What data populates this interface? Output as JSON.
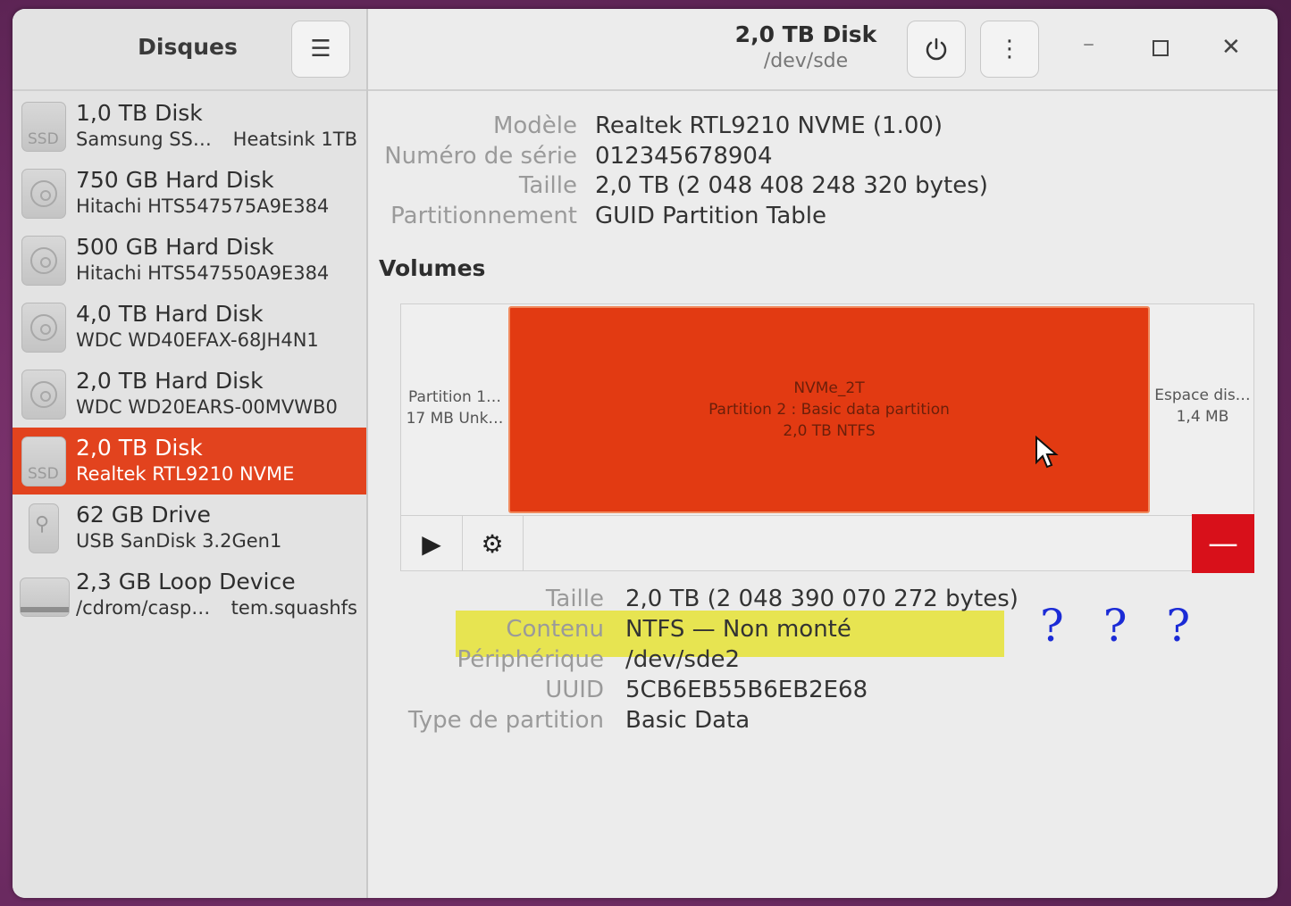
{
  "sidebar": {
    "title": "Disques",
    "menu_icon": "hamburger-menu-icon",
    "disks": [
      {
        "name": "1,0 TB Disk",
        "sub": "Samsung SS…",
        "sub_right": "Heatsink 1TB",
        "icon": "ssd-icon",
        "icon_label": "SSD"
      },
      {
        "name": "750 GB Hard Disk",
        "sub": "Hitachi HTS547575A9E384",
        "icon": "hard-disk-icon"
      },
      {
        "name": "500 GB Hard Disk",
        "sub": "Hitachi HTS547550A9E384",
        "icon": "hard-disk-icon"
      },
      {
        "name": "4,0 TB Hard Disk",
        "sub": "WDC WD40EFAX-68JH4N1",
        "icon": "hard-disk-icon"
      },
      {
        "name": "2,0 TB Hard Disk",
        "sub": "WDC WD20EARS-00MVWB0",
        "icon": "hard-disk-icon"
      },
      {
        "name": "2,0 TB Disk",
        "sub": "Realtek RTL9210 NVME",
        "icon": "ssd-icon",
        "icon_label": "SSD",
        "selected": true
      },
      {
        "name": "62 GB Drive",
        "sub": "USB SanDisk 3.2Gen1",
        "icon": "usb-drive-icon"
      },
      {
        "name": "2,3 GB Loop Device",
        "sub": "/cdrom/casp…",
        "sub_right": "tem.squashfs",
        "icon": "loop-device-icon"
      }
    ]
  },
  "header": {
    "title": "2,0 TB Disk",
    "subtitle": "/dev/sde",
    "power_icon": "power-icon",
    "more_icon": "vertical-dots-icon",
    "minimize_icon": "minimize-icon",
    "maximize_icon": "maximize-icon",
    "close_icon": "close-icon"
  },
  "disk_props": {
    "model_label": "Modèle",
    "model": "Realtek RTL9210 NVME (1.00)",
    "serial_label": "Numéro de série",
    "serial": "012345678904",
    "size_label": "Taille",
    "size": "2,0 TB (2 048 408 248 320 bytes)",
    "partitioning_label": "Partitionnement",
    "partitioning": "GUID Partition Table"
  },
  "volumes": {
    "title": "Volumes",
    "segments": [
      {
        "line1": "Partition 1…",
        "line2": "17 MB Unk…"
      },
      {
        "line0": "NVMe_2T",
        "line1": "Partition 2 : Basic data partition",
        "line2": "2,0 TB NTFS",
        "selected": true,
        "color": "#e23a12"
      },
      {
        "line1": "Espace dis…",
        "line2": "1,4 MB"
      }
    ],
    "toolbar": {
      "play_icon": "play-icon",
      "settings_icon": "gear-icon",
      "delete_icon": "minus-icon",
      "delete_label": "—"
    }
  },
  "partition_props": {
    "size_label": "Taille",
    "size": "2,0 TB (2 048 390 070 272 bytes)",
    "content_label": "Contenu",
    "content": "NTFS — Non monté",
    "device_label": "Périphérique",
    "device": "/dev/sde2",
    "uuid_label": "UUID",
    "uuid": "5CB6EB55B6EB2E68",
    "type_label": "Type de partition",
    "type": "Basic Data"
  },
  "annotation": {
    "text": "? ? ?",
    "highlight_color": "#e6e336",
    "text_color": "#1b2bd6"
  },
  "colors": {
    "accent": "#e2431e",
    "delete": "#d8101a"
  }
}
